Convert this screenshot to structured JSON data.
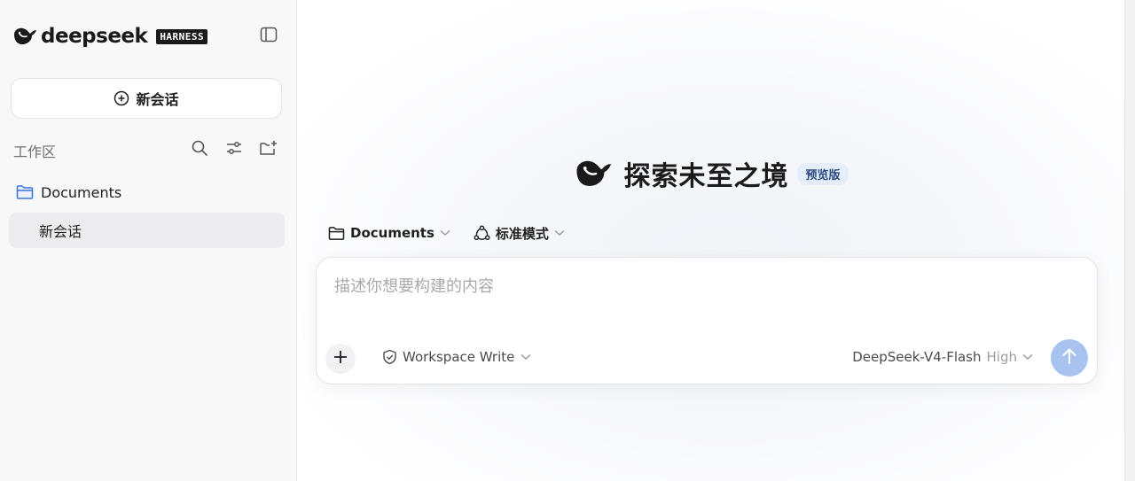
{
  "brand": {
    "name": "deepseek",
    "badge": "HARNESS",
    "logo_icon": "whale-logo-icon"
  },
  "sidebar": {
    "toggle_icon": "sidebar-toggle-icon",
    "new_chat_label": "新会话",
    "workspace_label": "工作区",
    "workspace_actions": [
      "search-icon",
      "filter-sliders-icon",
      "new-folder-icon"
    ],
    "folder": {
      "label": "Documents",
      "icon": "folder-icon"
    },
    "sessions": [
      {
        "label": "新会话",
        "selected": true
      }
    ]
  },
  "main": {
    "hero_title": "探索未至之境",
    "hero_badge": "预览版",
    "context": {
      "folder_label": "Documents",
      "mode_label": "标准模式"
    },
    "composer": {
      "placeholder": "描述你想要构建的内容",
      "value": "",
      "permission_label": "Workspace Write",
      "model_name": "DeepSeek-V4-Flash",
      "model_level": "High"
    }
  },
  "colors": {
    "sidebar_bg": "#f8f8f9",
    "selected_item_bg": "#ececee",
    "badge_bg": "#e6eefb",
    "send_button": "#a9c3f1"
  }
}
